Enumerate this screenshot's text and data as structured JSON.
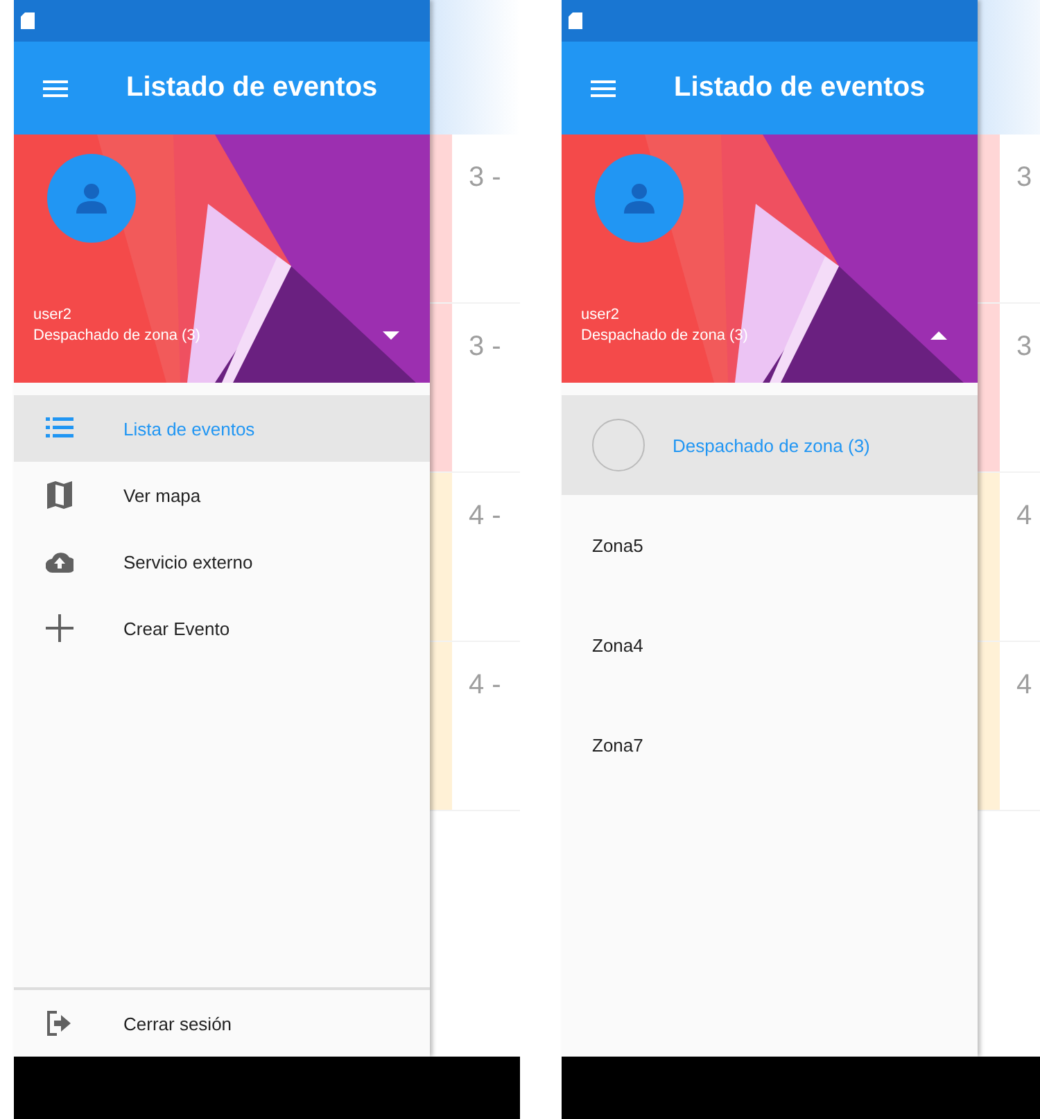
{
  "screens": [
    {
      "kind": "menu",
      "toolbar": {
        "title": "Listado de eventos"
      },
      "account": {
        "user": "user2",
        "role": "Despachado de zona (3)",
        "expanded": false
      },
      "items": [
        {
          "label": "Lista de eventos",
          "kind": "list",
          "selected": true
        },
        {
          "label": "Ver mapa",
          "kind": "map",
          "selected": false
        },
        {
          "label": "Servicio externo",
          "kind": "cloud",
          "selected": false
        },
        {
          "label": "Crear Evento",
          "kind": "plus",
          "selected": false
        }
      ],
      "footer_item": {
        "label": "Cerrar sesión",
        "kind": "logout"
      },
      "background_rows": [
        {
          "text": "3 -",
          "color": "#ffd6d6"
        },
        {
          "text": "3 -",
          "color": "#ffd6d6"
        },
        {
          "text": "4 -",
          "color": "#fff1d6"
        },
        {
          "text": "4 -",
          "color": "#fff1d6"
        }
      ]
    },
    {
      "kind": "accounts",
      "toolbar": {
        "title": "Listado de eventos"
      },
      "account": {
        "user": "user2",
        "role": "Despachado de zona (3)",
        "expanded": true
      },
      "accounts": [
        {
          "label": "Despachado de zona (3)",
          "selected": true
        },
        {
          "label": "Zona5",
          "selected": false
        },
        {
          "label": "Zona4",
          "selected": false
        },
        {
          "label": "Zona7",
          "selected": false
        }
      ],
      "background_rows": [
        {
          "text": "3",
          "color": "#ffd6d6"
        },
        {
          "text": "3",
          "color": "#ffd6d6"
        },
        {
          "text": "4",
          "color": "#fff1d6"
        },
        {
          "text": "4",
          "color": "#fff1d6"
        }
      ]
    }
  ]
}
